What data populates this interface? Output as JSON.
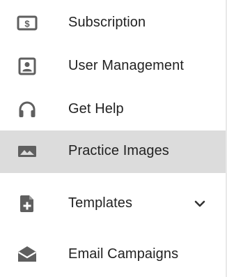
{
  "menu": {
    "items": [
      {
        "label": "Subscription",
        "icon": "dollar-card-icon"
      },
      {
        "label": "User Management",
        "icon": "account-box-icon"
      },
      {
        "label": "Get Help",
        "icon": "headset-icon"
      },
      {
        "label": "Practice Images",
        "icon": "image-icon",
        "active": true
      },
      {
        "label": "Templates",
        "icon": "file-add-icon",
        "expandable": true
      },
      {
        "label": "Email Campaigns",
        "icon": "drafts-envelope-icon"
      }
    ]
  },
  "colors": {
    "icon": "#5f5f5f",
    "text": "#222222",
    "active_background": "#dcdcdc",
    "divider": "#e9e9e9"
  }
}
